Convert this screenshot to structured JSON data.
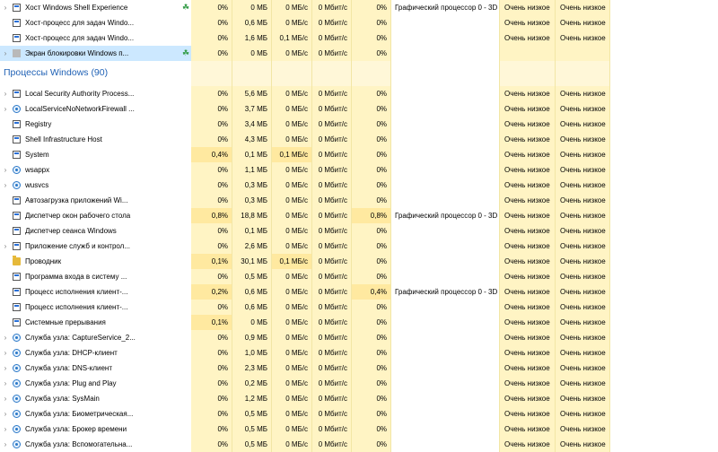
{
  "group_title": "Процессы Windows (90)",
  "rows_top": [
    {
      "name": "Хост Windows Shell Experience",
      "icon": "frame-icon",
      "expand": true,
      "leaf": true,
      "cpu": "0%",
      "mem": "0 МБ",
      "disk": "0 МБ/с",
      "net": "0 Мбит/с",
      "gpu": "0%",
      "engine": "Графический процессор 0 - 3D",
      "power": "Очень низкое",
      "trend": "Очень низкое"
    },
    {
      "name": "Хост-процесс для задач Windo...",
      "icon": "frame-icon",
      "expand": false,
      "leaf": false,
      "cpu": "0%",
      "mem": "0,6 МБ",
      "disk": "0 МБ/с",
      "net": "0 Мбит/с",
      "gpu": "0%",
      "engine": "",
      "power": "Очень низкое",
      "trend": "Очень низкое"
    },
    {
      "name": "Хост-процесс для задач Windo...",
      "icon": "frame-icon",
      "expand": false,
      "leaf": false,
      "cpu": "0%",
      "mem": "1,6 МБ",
      "disk": "0,1 МБ/с",
      "net": "0 Мбит/с",
      "gpu": "0%",
      "engine": "",
      "power": "Очень низкое",
      "trend": "Очень низкое"
    },
    {
      "name": "Экран блокировки Windows п...",
      "icon": "grey-app-icon",
      "expand": true,
      "leaf": true,
      "selected": true,
      "cpu": "0%",
      "mem": "0 МБ",
      "disk": "0 МБ/с",
      "net": "0 Мбит/с",
      "gpu": "0%",
      "engine": "",
      "power": "",
      "trend": ""
    }
  ],
  "rows": [
    {
      "name": "Local Security Authority Process...",
      "icon": "frame-icon",
      "expand": true,
      "cpu": "0%",
      "mem": "5,6 МБ",
      "disk": "0 МБ/с",
      "net": "0 Мбит/с",
      "gpu": "0%",
      "engine": "",
      "power": "Очень низкое",
      "trend": "Очень низкое"
    },
    {
      "name": "LocalServiceNoNetworkFirewall ...",
      "icon": "gear-icon",
      "expand": true,
      "cpu": "0%",
      "mem": "3,7 МБ",
      "disk": "0 МБ/с",
      "net": "0 Мбит/с",
      "gpu": "0%",
      "engine": "",
      "power": "Очень низкое",
      "trend": "Очень низкое"
    },
    {
      "name": "Registry",
      "icon": "frame-icon",
      "expand": false,
      "cpu": "0%",
      "mem": "3,4 МБ",
      "disk": "0 МБ/с",
      "net": "0 Мбит/с",
      "gpu": "0%",
      "engine": "",
      "power": "Очень низкое",
      "trend": "Очень низкое"
    },
    {
      "name": "Shell Infrastructure Host",
      "icon": "frame-icon",
      "expand": false,
      "cpu": "0%",
      "mem": "4,3 МБ",
      "disk": "0 МБ/с",
      "net": "0 Мбит/с",
      "gpu": "0%",
      "engine": "",
      "power": "Очень низкое",
      "trend": "Очень низкое"
    },
    {
      "name": "System",
      "icon": "frame-icon",
      "expand": false,
      "cpu": "0,4%",
      "cpu_warm": true,
      "mem": "0,1 МБ",
      "disk": "0,1 МБ/с",
      "disk_warm": true,
      "net": "0 Мбит/с",
      "gpu": "0%",
      "engine": "",
      "power": "Очень низкое",
      "trend": "Очень низкое"
    },
    {
      "name": "wsappx",
      "icon": "gear-icon",
      "expand": true,
      "cpu": "0%",
      "mem": "1,1 МБ",
      "disk": "0 МБ/с",
      "net": "0 Мбит/с",
      "gpu": "0%",
      "engine": "",
      "power": "Очень низкое",
      "trend": "Очень низкое"
    },
    {
      "name": "wusvcs",
      "icon": "gear-icon",
      "expand": true,
      "cpu": "0%",
      "mem": "0,3 МБ",
      "disk": "0 МБ/с",
      "net": "0 Мбит/с",
      "gpu": "0%",
      "engine": "",
      "power": "Очень низкое",
      "trend": "Очень низкое"
    },
    {
      "name": "Автозагрузка приложений Wi...",
      "icon": "frame-icon",
      "expand": false,
      "cpu": "0%",
      "mem": "0,3 МБ",
      "disk": "0 МБ/с",
      "net": "0 Мбит/с",
      "gpu": "0%",
      "engine": "",
      "power": "Очень низкое",
      "trend": "Очень низкое"
    },
    {
      "name": "Диспетчер окон рабочего стола",
      "icon": "frame-icon",
      "expand": false,
      "cpu": "0,8%",
      "cpu_warm": true,
      "mem": "18,8 МБ",
      "disk": "0 МБ/с",
      "net": "0 Мбит/с",
      "gpu": "0,8%",
      "gpu_warm": true,
      "engine": "Графический процессор 0 - 3D",
      "power": "Очень низкое",
      "trend": "Очень низкое"
    },
    {
      "name": "Диспетчер сеанса  Windows",
      "icon": "frame-icon",
      "expand": false,
      "cpu": "0%",
      "mem": "0,1 МБ",
      "disk": "0 МБ/с",
      "net": "0 Мбит/с",
      "gpu": "0%",
      "engine": "",
      "power": "Очень низкое",
      "trend": "Очень низкое"
    },
    {
      "name": "Приложение служб и контрол...",
      "icon": "frame-icon",
      "expand": true,
      "cpu": "0%",
      "mem": "2,6 МБ",
      "disk": "0 МБ/с",
      "net": "0 Мбит/с",
      "gpu": "0%",
      "engine": "",
      "power": "Очень низкое",
      "trend": "Очень низкое"
    },
    {
      "name": "Проводник",
      "icon": "folder-icon",
      "expand": false,
      "cpu": "0,1%",
      "cpu_warm": true,
      "mem": "30,1 МБ",
      "disk": "0,1 МБ/с",
      "disk_warm": true,
      "net": "0 Мбит/с",
      "gpu": "0%",
      "engine": "",
      "power": "Очень низкое",
      "trend": "Очень низкое"
    },
    {
      "name": "Программа входа в систему ...",
      "icon": "frame-icon",
      "expand": false,
      "cpu": "0%",
      "mem": "0,5 МБ",
      "disk": "0 МБ/с",
      "net": "0 Мбит/с",
      "gpu": "0%",
      "engine": "",
      "power": "Очень низкое",
      "trend": "Очень низкое"
    },
    {
      "name": "Процесс исполнения клиент-...",
      "icon": "frame-icon",
      "expand": false,
      "cpu": "0,2%",
      "cpu_warm": true,
      "mem": "0,6 МБ",
      "disk": "0 МБ/с",
      "net": "0 Мбит/с",
      "gpu": "0,4%",
      "gpu_warm": true,
      "engine": "Графический процессор 0 - 3D",
      "power": "Очень низкое",
      "trend": "Очень низкое"
    },
    {
      "name": "Процесс исполнения клиент-...",
      "icon": "frame-icon",
      "expand": false,
      "cpu": "0%",
      "mem": "0,6 МБ",
      "disk": "0 МБ/с",
      "net": "0 Мбит/с",
      "gpu": "0%",
      "engine": "",
      "power": "Очень низкое",
      "trend": "Очень низкое"
    },
    {
      "name": "Системные прерывания",
      "icon": "frame-icon",
      "expand": false,
      "cpu": "0,1%",
      "cpu_warm": true,
      "mem": "0 МБ",
      "disk": "0 МБ/с",
      "net": "0 Мбит/с",
      "gpu": "0%",
      "engine": "",
      "power": "Очень низкое",
      "trend": "Очень низкое"
    },
    {
      "name": "Служба узла: CaptureService_2...",
      "icon": "gear-icon",
      "expand": true,
      "cpu": "0%",
      "mem": "0,9 МБ",
      "disk": "0 МБ/с",
      "net": "0 Мбит/с",
      "gpu": "0%",
      "engine": "",
      "power": "Очень низкое",
      "trend": "Очень низкое"
    },
    {
      "name": "Служба узла: DHCP-клиент",
      "icon": "gear-icon",
      "expand": true,
      "cpu": "0%",
      "mem": "1,0 МБ",
      "disk": "0 МБ/с",
      "net": "0 Мбит/с",
      "gpu": "0%",
      "engine": "",
      "power": "Очень низкое",
      "trend": "Очень низкое"
    },
    {
      "name": "Служба узла: DNS-клиент",
      "icon": "gear-icon",
      "expand": true,
      "cpu": "0%",
      "mem": "2,3 МБ",
      "disk": "0 МБ/с",
      "net": "0 Мбит/с",
      "gpu": "0%",
      "engine": "",
      "power": "Очень низкое",
      "trend": "Очень низкое"
    },
    {
      "name": "Служба узла: Plug and Play",
      "icon": "gear-icon",
      "expand": true,
      "cpu": "0%",
      "mem": "0,2 МБ",
      "disk": "0 МБ/с",
      "net": "0 Мбит/с",
      "gpu": "0%",
      "engine": "",
      "power": "Очень низкое",
      "trend": "Очень низкое"
    },
    {
      "name": "Служба узла: SysMain",
      "icon": "gear-icon",
      "expand": true,
      "cpu": "0%",
      "mem": "1,2 МБ",
      "disk": "0 МБ/с",
      "net": "0 Мбит/с",
      "gpu": "0%",
      "engine": "",
      "power": "Очень низкое",
      "trend": "Очень низкое"
    },
    {
      "name": "Служба узла: Биометрическая...",
      "icon": "gear-icon",
      "expand": true,
      "cpu": "0%",
      "mem": "0,5 МБ",
      "disk": "0 МБ/с",
      "net": "0 Мбит/с",
      "gpu": "0%",
      "engine": "",
      "power": "Очень низкое",
      "trend": "Очень низкое"
    },
    {
      "name": "Служба узла: Брокер времени",
      "icon": "gear-icon",
      "expand": true,
      "cpu": "0%",
      "mem": "0,5 МБ",
      "disk": "0 МБ/с",
      "net": "0 Мбит/с",
      "gpu": "0%",
      "engine": "",
      "power": "Очень низкое",
      "trend": "Очень низкое"
    },
    {
      "name": "Служба узла: Вспомогательна...",
      "icon": "gear-icon",
      "expand": true,
      "cpu": "0%",
      "mem": "0,5 МБ",
      "disk": "0 МБ/с",
      "net": "0 Мбит/с",
      "gpu": "0%",
      "engine": "",
      "power": "Очень низкое",
      "trend": "Очень низкое"
    }
  ],
  "icons": {
    "expand": "chevron-right-icon",
    "leaf": "leaf-icon"
  },
  "colors": {
    "group_title": "#1f61b5",
    "heat_light": "#fff4c4",
    "heat_warm": "#ffe9a0",
    "selected": "#cce8ff"
  }
}
